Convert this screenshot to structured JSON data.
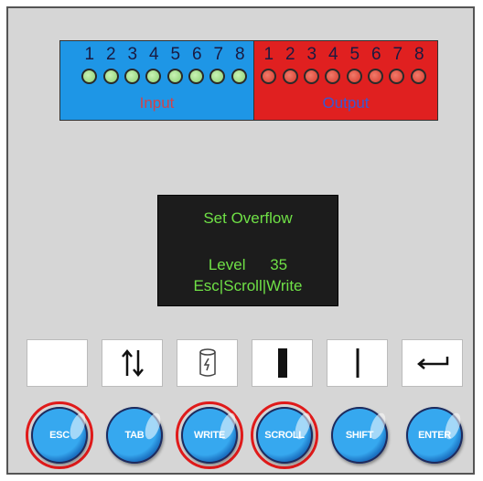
{
  "io_panel": {
    "input_label": "Input",
    "output_label": "Output",
    "input_numbers": [
      "1",
      "2",
      "3",
      "4",
      "5",
      "6",
      "7",
      "8"
    ],
    "output_numbers": [
      "1",
      "2",
      "3",
      "4",
      "5",
      "6",
      "7",
      "8"
    ],
    "input_led_color": "#8ad070",
    "output_led_color": "#d83a2c"
  },
  "lcd": {
    "line1": "Set Overflow",
    "level_label": "Level",
    "level_value": "35",
    "line3": "Esc|Scroll|Write",
    "text_color": "#6fe046"
  },
  "softkeys": [
    {
      "icon": "blank"
    },
    {
      "icon": "up-down-arrows-icon"
    },
    {
      "icon": "battery-icon"
    },
    {
      "icon": "thick-bar-icon"
    },
    {
      "icon": "thin-bar-icon"
    },
    {
      "icon": "enter-arrow-icon"
    }
  ],
  "buttons": [
    {
      "label": "ESC",
      "highlighted": true
    },
    {
      "label": "TAB",
      "highlighted": false
    },
    {
      "label": "WRITE",
      "highlighted": true
    },
    {
      "label": "SCROLL",
      "highlighted": true
    },
    {
      "label": "SHIFT",
      "highlighted": false
    },
    {
      "label": "ENTER",
      "highlighted": false
    }
  ],
  "highlight_color": "#e01a1a"
}
